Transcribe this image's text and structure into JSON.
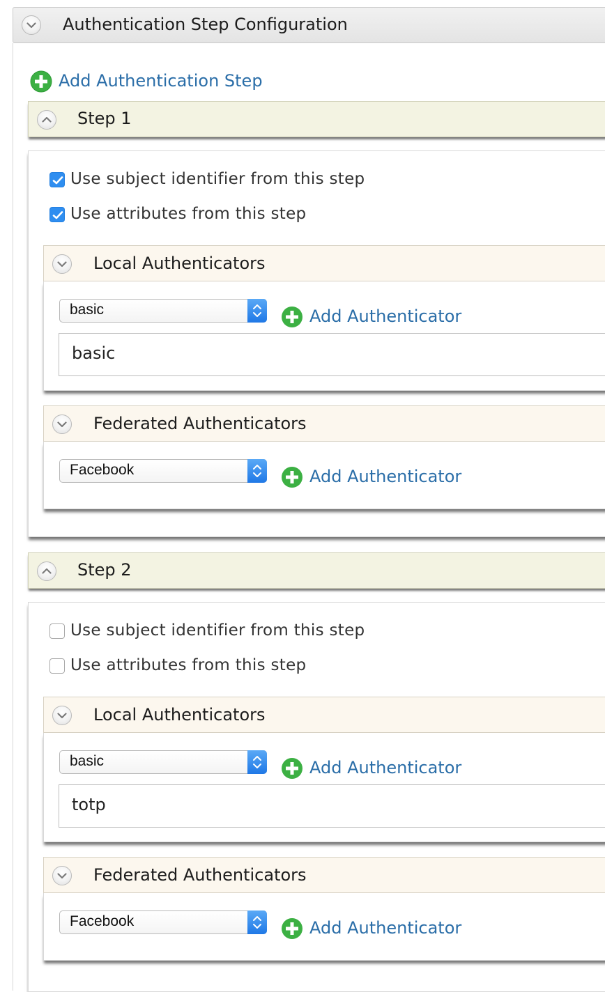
{
  "section": {
    "title": "Authentication Step Configuration",
    "add_step_label": "Add Authentication Step"
  },
  "steps": [
    {
      "title": "Step 1",
      "use_subject_label": "Use subject identifier from this step",
      "use_subject_checked": true,
      "use_attributes_label": "Use attributes from this step",
      "use_attributes_checked": true,
      "local": {
        "title": "Local Authenticators",
        "selected": "basic",
        "add_label": "Add Authenticator",
        "items": [
          "basic"
        ]
      },
      "federated": {
        "title": "Federated Authenticators",
        "selected": "Facebook",
        "add_label": "Add Authenticator"
      }
    },
    {
      "title": "Step 2",
      "use_subject_label": "Use subject identifier from this step",
      "use_subject_checked": false,
      "use_attributes_label": "Use attributes from this step",
      "use_attributes_checked": false,
      "local": {
        "title": "Local Authenticators",
        "selected": "basic",
        "add_label": "Add Authenticator",
        "items": [
          "totp"
        ]
      },
      "federated": {
        "title": "Federated Authenticators",
        "selected": "Facebook",
        "add_label": "Add Authenticator"
      }
    }
  ],
  "icons": {
    "collapse": "chevron-down-icon",
    "expand": "chevron-up-icon",
    "add": "plus-circle-icon",
    "select_arrows": "updown-arrows-icon",
    "check": "checkmark-icon"
  },
  "colors": {
    "link": "#2b6ea8",
    "add_icon": "#3cb043",
    "checkbox_checked": "#2f8ef0",
    "step_header_bg": "#f3f3e2",
    "sub_header_bg": "#fcf7ee"
  }
}
